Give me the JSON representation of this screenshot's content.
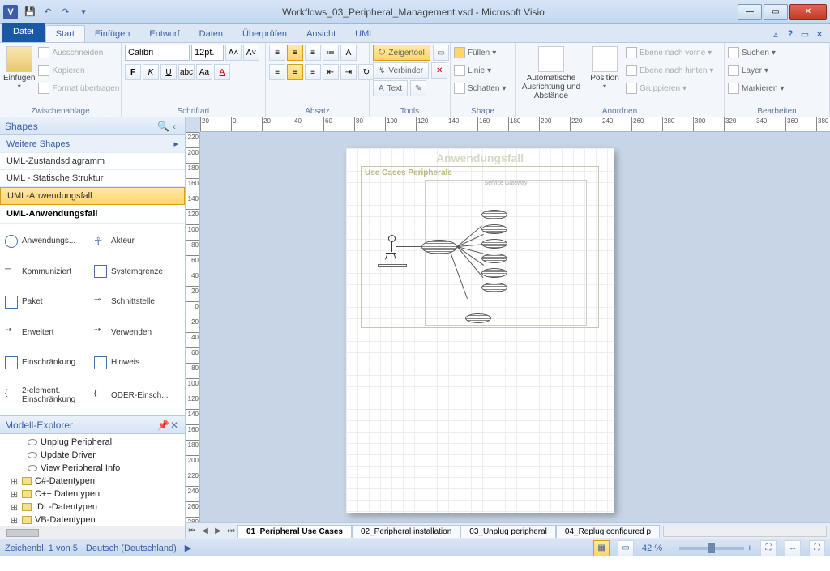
{
  "title": "Workflows_03_Peripheral_Management.vsd - Microsoft Visio",
  "tabs": {
    "file": "Datei",
    "items": [
      "Start",
      "Einfügen",
      "Entwurf",
      "Daten",
      "Überprüfen",
      "Ansicht",
      "UML"
    ],
    "active": 0
  },
  "ribbon": {
    "clipboard": {
      "label": "Zwischenablage",
      "paste": "Einfügen",
      "cut": "Ausschneiden",
      "copy": "Kopieren",
      "format": "Format übertragen"
    },
    "font": {
      "label": "Schriftart",
      "name": "Calibri",
      "size": "12pt."
    },
    "paragraph": {
      "label": "Absatz"
    },
    "tools": {
      "label": "Tools",
      "pointer": "Zeigertool",
      "connector": "Verbinder",
      "text": "Text"
    },
    "shape": {
      "label": "Shape",
      "fill": "Füllen",
      "line": "Linie",
      "shadow": "Schatten"
    },
    "arrange": {
      "label": "Anordnen",
      "auto": "Automatische Ausrichtung und Abstände",
      "position": "Position",
      "front": "Ebene nach vorne",
      "back": "Ebene nach hinten",
      "group": "Gruppieren"
    },
    "edit": {
      "label": "Bearbeiten",
      "find": "Suchen",
      "layer": "Layer",
      "select": "Markieren"
    }
  },
  "shapes_panel": {
    "title": "Shapes",
    "more": "Weitere Shapes",
    "lists": [
      "UML-Zustandsdiagramm",
      "UML - Statische Struktur",
      "UML-Anwendungsfall"
    ],
    "stencil_title": "UML-Anwendungsfall",
    "items": [
      {
        "label": "Anwendungs...",
        "icon": "ellipse"
      },
      {
        "label": "Akteur",
        "icon": "actor"
      },
      {
        "label": "Kommuniziert",
        "icon": "line"
      },
      {
        "label": "Systemgrenze",
        "icon": "rect"
      },
      {
        "label": "Paket",
        "icon": "folder"
      },
      {
        "label": "Schnittstelle",
        "icon": "lolli"
      },
      {
        "label": "Erweitert",
        "icon": "arrow"
      },
      {
        "label": "Verwenden",
        "icon": "arrow"
      },
      {
        "label": "Einschränkung",
        "icon": "note"
      },
      {
        "label": "Hinweis",
        "icon": "note"
      },
      {
        "label": "2-element. Einschränkung",
        "icon": "brace"
      },
      {
        "label": "ODER-Einsch...",
        "icon": "brace"
      }
    ]
  },
  "explorer": {
    "title": "Modell-Explorer",
    "usecases": [
      "Unplug Peripheral",
      "Update Driver",
      "View Peripheral Info"
    ],
    "datatypes": [
      "C#-Datentypen",
      "C++ Datentypen",
      "IDL-Datentypen",
      "VB-Datentypen"
    ]
  },
  "canvas": {
    "watermark": "Anwendungsfall",
    "box_label": "Use Cases Peripherals",
    "gateway_label": "Service Gateway"
  },
  "page_tabs": [
    "01_Peripheral Use Cases",
    "02_Peripheral installation",
    "03_Unplug peripheral",
    "04_Replug configured p"
  ],
  "status": {
    "page": "Zeichenbl. 1 von 5",
    "lang": "Deutsch (Deutschland)",
    "zoom": "42 %"
  },
  "ruler_h": [
    "20",
    "0",
    "20",
    "40",
    "60",
    "80",
    "100",
    "120",
    "140",
    "160",
    "180",
    "200",
    "220",
    "240",
    "260",
    "280",
    "300",
    "320",
    "340",
    "360",
    "380"
  ],
  "ruler_v": [
    "220",
    "200",
    "180",
    "160",
    "140",
    "120",
    "100",
    "80",
    "60",
    "40",
    "20",
    "0",
    "20",
    "40",
    "60",
    "80",
    "100",
    "120",
    "140",
    "160",
    "180",
    "200",
    "220",
    "240",
    "260",
    "280"
  ]
}
